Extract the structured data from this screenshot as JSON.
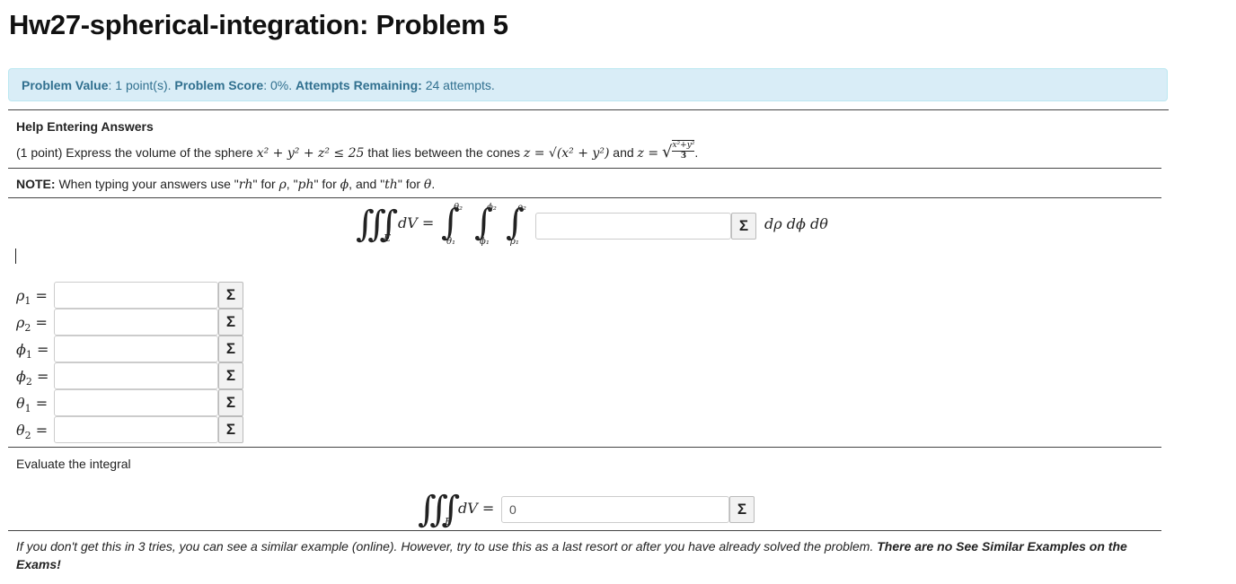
{
  "page": {
    "title": "Hw27-spherical-integration: Problem 5"
  },
  "info": {
    "value_label": "Problem Value",
    "value_text": ": 1 point(s).",
    "score_label": "Problem Score",
    "score_text": ": 0%.",
    "attempts_label": "Attempts Remaining:",
    "attempts_text": "24 attempts."
  },
  "help": {
    "link_text": "Help Entering Answers"
  },
  "problem": {
    "prefix": "(1 point) Express the volume of the sphere",
    "sphere_ineq": "x² + y² + z² ≤ 25",
    "middle": "that lies between the cones",
    "cone1": "z = √(x² + y²)",
    "and": "and",
    "cone2_lhs": "z =",
    "cone2_num": "x²+y²",
    "cone2_den": "3",
    "period": "."
  },
  "note": {
    "label": "NOTE:",
    "text1": "When typing your answers use \"",
    "rh": "rh",
    "text2": "\" for",
    "rho": "ρ",
    "text3": ", \"",
    "ph": "ph",
    "text4": "\" for",
    "phi": "ϕ",
    "text5": ", and \"",
    "th": "th",
    "text6": "\" for",
    "theta": "θ",
    "text7": "."
  },
  "integral": {
    "lhs_sym": "∭",
    "domain": "E",
    "dv": "dV =",
    "limits": [
      {
        "upper": "θ₂",
        "lower": "θ₁"
      },
      {
        "upper": "ϕ₂",
        "lower": "ϕ₁"
      },
      {
        "upper": "ρ₂",
        "lower": "ρ₁"
      }
    ],
    "integrand_value": "",
    "differentials": "dρ dϕ dθ",
    "sigma": "Σ"
  },
  "bounds": [
    {
      "sym": "ρ",
      "sub": "1",
      "value": ""
    },
    {
      "sym": "ρ",
      "sub": "2",
      "value": ""
    },
    {
      "sym": "ϕ",
      "sub": "1",
      "value": ""
    },
    {
      "sym": "ϕ",
      "sub": "2",
      "value": ""
    },
    {
      "sym": "θ",
      "sub": "1",
      "value": ""
    },
    {
      "sym": "θ",
      "sub": "2",
      "value": ""
    }
  ],
  "eval": {
    "label": "Evaluate the integral",
    "lhs_sym": "∭",
    "domain": "E",
    "dv": "dV =",
    "value": "0"
  },
  "footer": {
    "text": "If you don't get this in 3 tries, you can see a similar example (online). However, try to use this as a last resort or after you have already solved the problem.",
    "bold_text": "There are no See Similar Examples on the Exams!"
  }
}
